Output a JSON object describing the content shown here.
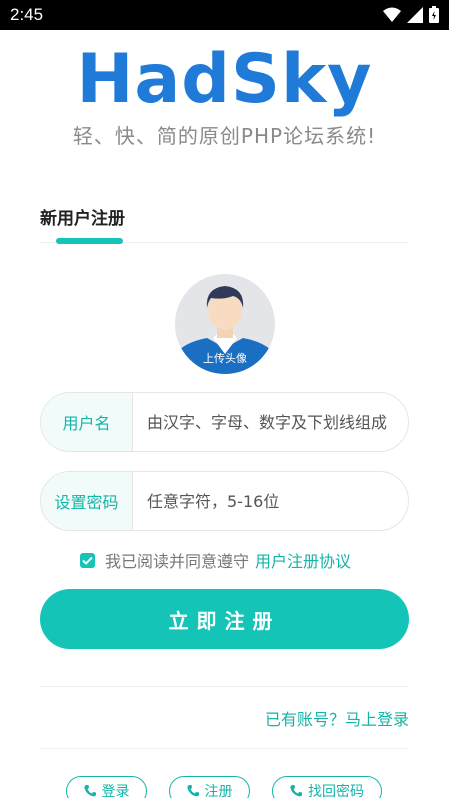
{
  "status_bar": {
    "time": "2:45"
  },
  "logo": {
    "text": "HadSky",
    "slogan": "轻、快、简的原创PHP论坛系统!"
  },
  "tab": {
    "title": "新用户注册"
  },
  "avatar": {
    "label": "上传头像"
  },
  "form": {
    "username": {
      "label": "用户名",
      "placeholder": "由汉字、字母、数字及下划线组成"
    },
    "password": {
      "label": "设置密码",
      "placeholder": "任意字符，5-16位"
    }
  },
  "agreement": {
    "text": "我已阅读并同意遵守",
    "link": "用户注册协议",
    "checked": true
  },
  "register_button": {
    "label": "立即注册"
  },
  "login_link": {
    "label": "已有账号？马上登录"
  },
  "bottom_links": [
    {
      "label": "登录",
      "icon": "phone-icon"
    },
    {
      "label": "注册",
      "icon": "phone-icon"
    },
    {
      "label": "找回密码",
      "icon": "phone-icon"
    }
  ],
  "colors": {
    "accent": "#14c4b6",
    "logo": "#1f7ad8"
  }
}
